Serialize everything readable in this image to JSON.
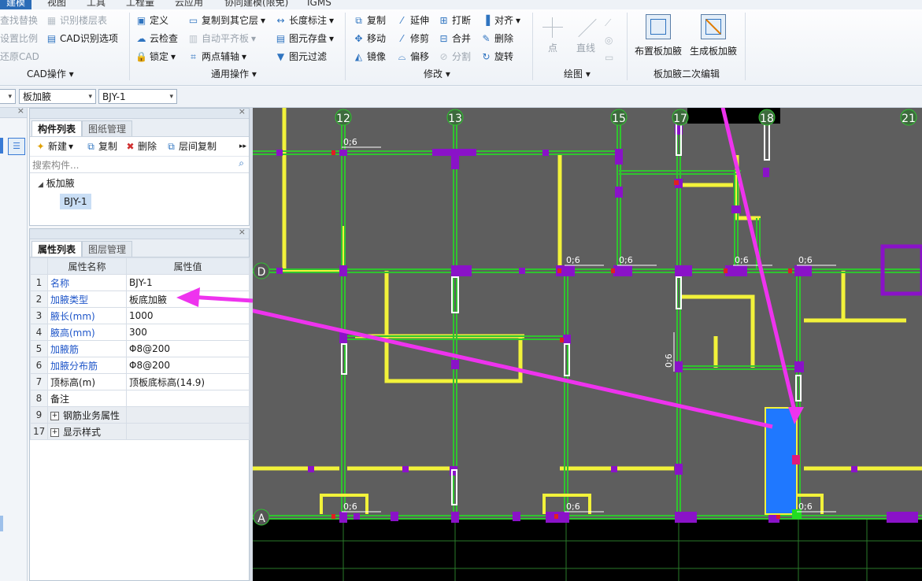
{
  "menu": [
    "建模",
    "视图",
    "工具",
    "工程量",
    "云应用",
    "协同建模(限免)",
    "IGMS"
  ],
  "ribbon": {
    "cad": {
      "items": [
        "查找替换",
        "识别楼层表",
        "设置比例",
        "CAD识别选项",
        "还原CAD"
      ],
      "label": "CAD操作"
    },
    "general": {
      "items": [
        "定义",
        "复制到其它层",
        "长度标注",
        "云检查",
        "自动平齐板",
        "图元存盘",
        "锁定",
        "两点辅轴",
        "图元过滤"
      ],
      "label": "通用操作"
    },
    "modify": {
      "items": [
        "复制",
        "延伸",
        "打断",
        "对齐",
        "移动",
        "修剪",
        "合并",
        "删除",
        "镜像",
        "偏移",
        "分割",
        "旋转"
      ],
      "label": "修改"
    },
    "draw": {
      "items": [
        "点",
        "直线"
      ],
      "label": "绘图"
    },
    "edit": {
      "items": [
        "布置板加腋",
        "生成板加腋"
      ],
      "label": "板加腋二次编辑"
    }
  },
  "selectors": {
    "type": "板加腋",
    "component": "BJY-1"
  },
  "component_panel": {
    "tabs": [
      "构件列表",
      "图纸管理"
    ],
    "toolbar": [
      "新建",
      "复制",
      "删除",
      "层间复制"
    ],
    "search_placeholder": "搜索构件...",
    "tree_root": "板加腋",
    "tree_child": "BJY-1"
  },
  "property_panel": {
    "tabs": [
      "属性列表",
      "图层管理"
    ],
    "headers": [
      "属性名称",
      "属性值"
    ],
    "rows": [
      {
        "num": "1",
        "name": "名称",
        "value": "BJY-1"
      },
      {
        "num": "2",
        "name": "加腋类型",
        "value": "板底加腋"
      },
      {
        "num": "3",
        "name": "腋长(mm)",
        "value": "1000"
      },
      {
        "num": "4",
        "name": "腋高(mm)",
        "value": "300"
      },
      {
        "num": "5",
        "name": "加腋筋",
        "value": "Φ8@200"
      },
      {
        "num": "6",
        "name": "加腋分布筋",
        "value": "Φ8@200"
      },
      {
        "num": "7",
        "name": "顶标高(m)",
        "value": "顶板底标高(14.9)"
      },
      {
        "num": "8",
        "name": "备注",
        "value": ""
      },
      {
        "num": "9",
        "name": "钢筋业务属性",
        "value": ""
      },
      {
        "num": "17",
        "name": "显示样式",
        "value": ""
      }
    ]
  },
  "canvas": {
    "axes_x": [
      "12",
      "13",
      "15",
      "17",
      "18",
      "21"
    ],
    "axes_y": [
      "D",
      "A"
    ],
    "dim_label": "0;6"
  },
  "colors": {
    "background": "#5e5e5e",
    "beam_green": "#2fc42f",
    "wall_yellow": "#f2f23a",
    "column_purple": "#8a12c8",
    "slab_blue": "#1f78ff",
    "arrow_magenta": "#ee33ee"
  }
}
